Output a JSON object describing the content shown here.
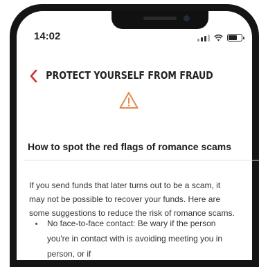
{
  "status_bar": {
    "time": "14:02"
  },
  "header": {
    "back_icon": "chevron-left-icon",
    "title": "PROTECT YOURSELF FROM FRAUD",
    "warning_icon": "warning-triangle-icon",
    "accent_color": "#d0312d"
  },
  "content": {
    "subtitle": "How to spot the red flags of romance scams",
    "intro": "If you send funds that later turns out to be a scam, it may not be possible to recover your funds. Here are some suggestions to reduce the risk of romance scams.",
    "bullets": [
      "No face-to-face contact: Be wary if the person you're in contact with is avoiding meeting you in person, or if"
    ]
  }
}
